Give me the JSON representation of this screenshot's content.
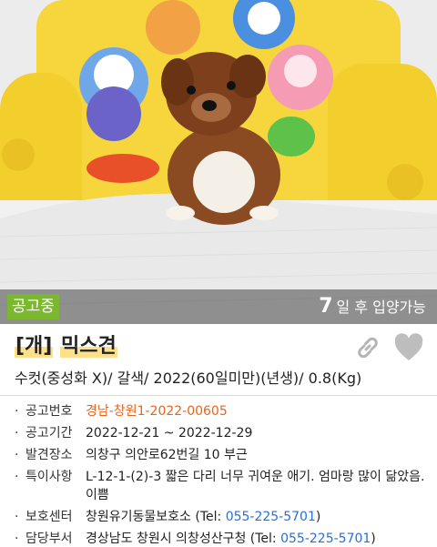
{
  "status": {
    "badge": "공고중",
    "adopt_days": "7",
    "adopt_text": "일 후 입양가능"
  },
  "title": {
    "category": "[개]",
    "breed": "믹스견"
  },
  "summary": "수컷(중성화 X)/ 갈색/ 2022(60일미만)(년생)/ 0.8(Kg)",
  "info": [
    {
      "label": "공고번호",
      "value": "경남-창원1-2022-00605",
      "color": "orange"
    },
    {
      "label": "공고기간",
      "value": "2022-12-21 ~ 2022-12-29"
    },
    {
      "label": "발견장소",
      "value": "의창구 의안로62번길 10 부근"
    },
    {
      "label": "특이사항",
      "value": "L-12-1-(2)-3   짧은 다리 너무 귀여운 애기. 엄마랑 많이 닮았음. 이쁨"
    },
    {
      "label": "보호센터",
      "value": "창원유기동물보호소",
      "tel_prefix": "(Tel: ",
      "tel": "055-225-5701",
      "tel_suffix": ")"
    },
    {
      "label": "담당부서",
      "value": "경상남도 창원시 의창성산구청",
      "tel_prefix": "(Tel: ",
      "tel": "055-225-5701",
      "tel_suffix": ")"
    }
  ],
  "colors": {
    "status_badge": "#7cb82f",
    "highlight": "#ffe08a",
    "notice_number": "#e8641b",
    "tel": "#2a6fd6"
  },
  "icons": [
    "link-icon",
    "heart-icon"
  ]
}
